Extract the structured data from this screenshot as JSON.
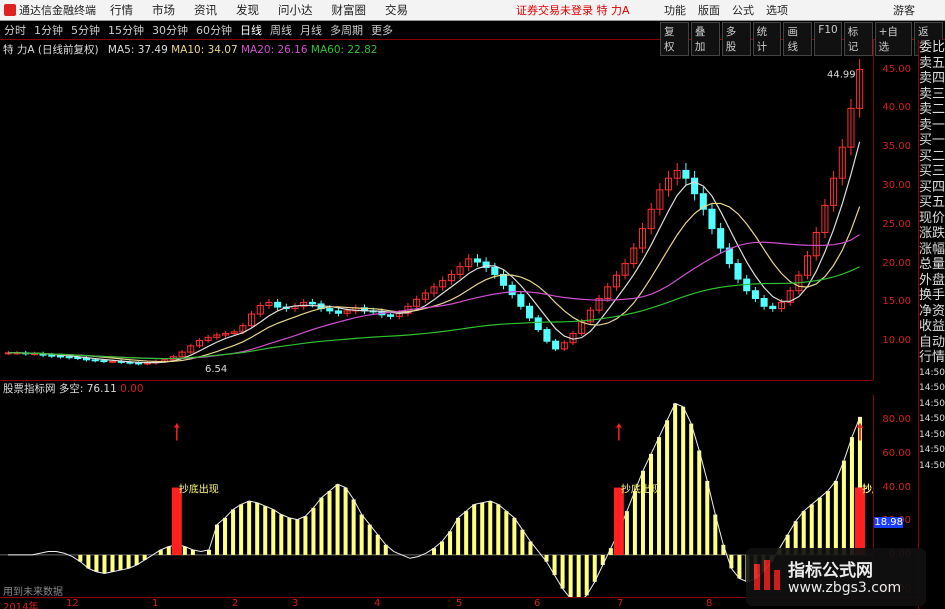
{
  "titlebar": {
    "app_title": "通达信金融终端",
    "menus": [
      "行情",
      "市场",
      "资讯",
      "发现",
      "问小达",
      "财富圈",
      "交易"
    ],
    "login_status": "证券交易未登录  特 力A",
    "right_menus": [
      "功能",
      "版面",
      "公式",
      "选项"
    ],
    "guest": "游客"
  },
  "periodbar": {
    "periods": [
      "分时",
      "1分钟",
      "5分钟",
      "15分钟",
      "30分钟",
      "60分钟",
      "日线",
      "周线",
      "月线",
      "多周期",
      "更多"
    ],
    "active": "日线",
    "tools": [
      "复权",
      "叠加",
      "多股",
      "统计",
      "画线",
      "F10",
      "标记",
      "+自选",
      "返回"
    ]
  },
  "main_legend": {
    "title": "特 力A (日线前复权)",
    "ma5": "MA5: 37.49",
    "ma10": "MA10: 34.07",
    "ma20": "MA20: 26.16",
    "ma60": "MA60: 22.82"
  },
  "price_annotations": {
    "high": "44.99",
    "low": "6.54"
  },
  "main_axis_ticks": [
    "45.00",
    "40.00",
    "35.00",
    "30.00",
    "25.00",
    "20.00",
    "15.00",
    "10.00"
  ],
  "sub_legend": {
    "name": "股票指标网 多空: 76.11",
    "zero": "0.00"
  },
  "sub_axis_ticks": [
    "80.00",
    "60.00",
    "40.00",
    "20.00",
    "0.00",
    "-20.00"
  ],
  "sub_axis_current": "18.98",
  "signal_label": "抄底出现",
  "footer_note": "用到未来数据",
  "dates": [
    "2014年",
    "12",
    "1",
    "2",
    "3",
    "4",
    "5",
    "6",
    "7",
    "8"
  ],
  "side_panel": [
    "委比",
    "卖五",
    "卖四",
    "卖三",
    "卖二",
    "卖一",
    "买一",
    "买二",
    "买三",
    "买四",
    "买五",
    "现价",
    "涨跌",
    "涨幅",
    "总量",
    "外盘",
    "换手",
    "净资",
    "收益",
    "自动",
    "行情",
    "14:50",
    "14:50",
    "14:50",
    "14:50",
    "14:50",
    "14:50",
    "14:50"
  ],
  "watermark": {
    "line1": "指标公式网",
    "line2": "www.zbgs3.com"
  },
  "colors": {
    "up": "#ff3030",
    "down": "#54ffff",
    "bar_yellow": "#ffff80",
    "signal_red": "#ff2020",
    "axis": "#8b0000"
  },
  "chart_data": {
    "type": "line",
    "main_price_range": [
      5,
      47
    ],
    "indicator_range": [
      -25,
      95
    ],
    "indicator_values": [
      0,
      0,
      0,
      0,
      1,
      2,
      2,
      1,
      -1,
      -4,
      -8,
      -10,
      -11,
      -10,
      -9,
      -8,
      -6,
      -3,
      0,
      3,
      5,
      6,
      5,
      3,
      2,
      3,
      18,
      22,
      27,
      30,
      32,
      31,
      29,
      27,
      24,
      22,
      21,
      23,
      28,
      34,
      38,
      42,
      40,
      33,
      24,
      18,
      12,
      6,
      2,
      0,
      -2,
      -1,
      1,
      4,
      8,
      14,
      22,
      26,
      30,
      31,
      32,
      30,
      26,
      22,
      15,
      8,
      2,
      -4,
      -12,
      -20,
      -26,
      -28,
      -24,
      -16,
      -6,
      4,
      14,
      26,
      38,
      50,
      60,
      70,
      80,
      90,
      88,
      78,
      62,
      44,
      24,
      6,
      -8,
      -14,
      -16,
      -14,
      -10,
      -4,
      4,
      12,
      20,
      26,
      30,
      34,
      38,
      44,
      56,
      70,
      82
    ],
    "signals": [
      21,
      76,
      106,
      141,
      157
    ],
    "price_close": [
      8.5,
      8.5,
      8.4,
      8.4,
      8.2,
      8.1,
      8.0,
      7.9,
      7.8,
      7.6,
      7.5,
      7.4,
      7.4,
      7.3,
      7.2,
      7.1,
      7.2,
      7.4,
      7.6,
      8.0,
      8.6,
      9.4,
      10.1,
      10.5,
      10.8,
      11.0,
      11.2,
      12.0,
      13.5,
      14.6,
      15.0,
      14.4,
      14.2,
      14.5,
      15.0,
      14.8,
      14.2,
      13.9,
      13.6,
      13.9,
      14.3,
      13.9,
      13.8,
      13.4,
      13.2,
      13.6,
      14.5,
      15.4,
      16.2,
      17.0,
      17.8,
      18.6,
      19.6,
      20.6,
      20.2,
      19.5,
      18.6,
      17.2,
      16.0,
      14.5,
      13.0,
      11.5,
      10.0,
      9.0,
      9.8,
      11.0,
      12.5,
      14.0,
      15.5,
      17.0,
      18.5,
      20.0,
      22.0,
      24.5,
      27.0,
      29.5,
      31.0,
      32.0,
      31.0,
      29.0,
      27.0,
      24.5,
      22.0,
      20.0,
      18.0,
      16.5,
      15.5,
      14.5,
      14.2,
      15.0,
      16.5,
      18.5,
      21.0,
      24.0,
      27.5,
      31.0,
      35.0,
      40.0,
      44.99
    ]
  }
}
